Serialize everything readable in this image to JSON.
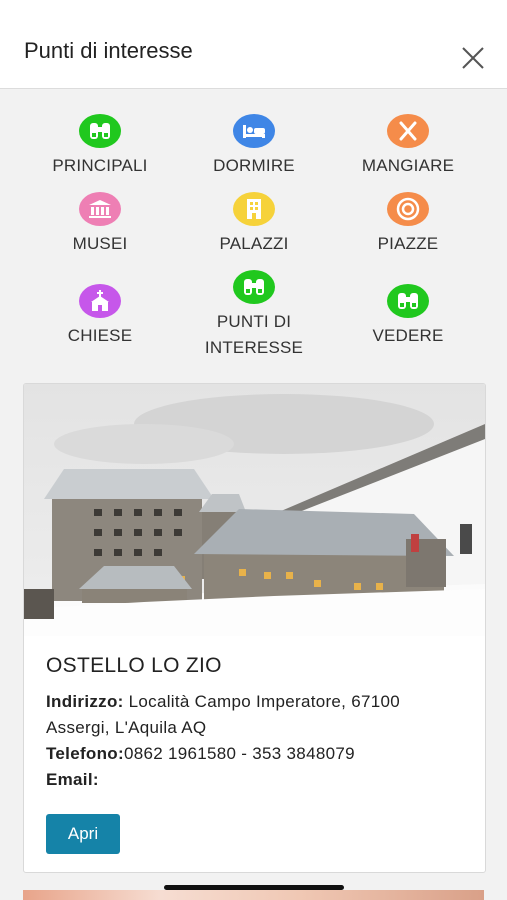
{
  "header": {
    "title": "Punti di interesse"
  },
  "colors": {
    "green": "#20c81e",
    "blue": "#3f86e6",
    "orange": "#f58c4a",
    "pink": "#ee7fb4",
    "yellow": "#f6d23a",
    "purple": "#c657ea",
    "button": "#1583a8"
  },
  "categories": [
    {
      "label": "PRINCIPALI",
      "icon": "binoculars-icon"
    },
    {
      "label": "DORMIRE",
      "icon": "bed-icon"
    },
    {
      "label": "MANGIARE",
      "icon": "fork-knife-icon"
    },
    {
      "label": "MUSEI",
      "icon": "museum-icon"
    },
    {
      "label": "PALAZZI",
      "icon": "building-icon"
    },
    {
      "label": "PIAZZE",
      "icon": "target-icon"
    },
    {
      "label": "CHIESE",
      "icon": "church-icon"
    },
    {
      "label": "PUNTI DI INTERESSE",
      "icon": "binoculars-icon"
    },
    {
      "label": "VEDERE",
      "icon": "binoculars-icon"
    }
  ],
  "card": {
    "title": "OSTELLO LO ZIO",
    "address_label": "Indirizzo:",
    "address": "Località Campo Imperatore, 67100 Assergi, L'Aquila AQ",
    "phone_label": "Telefono:",
    "phone": "0862 1961580 - 353 3848079",
    "email_label": "Email:",
    "email": "",
    "button": "Apri"
  }
}
